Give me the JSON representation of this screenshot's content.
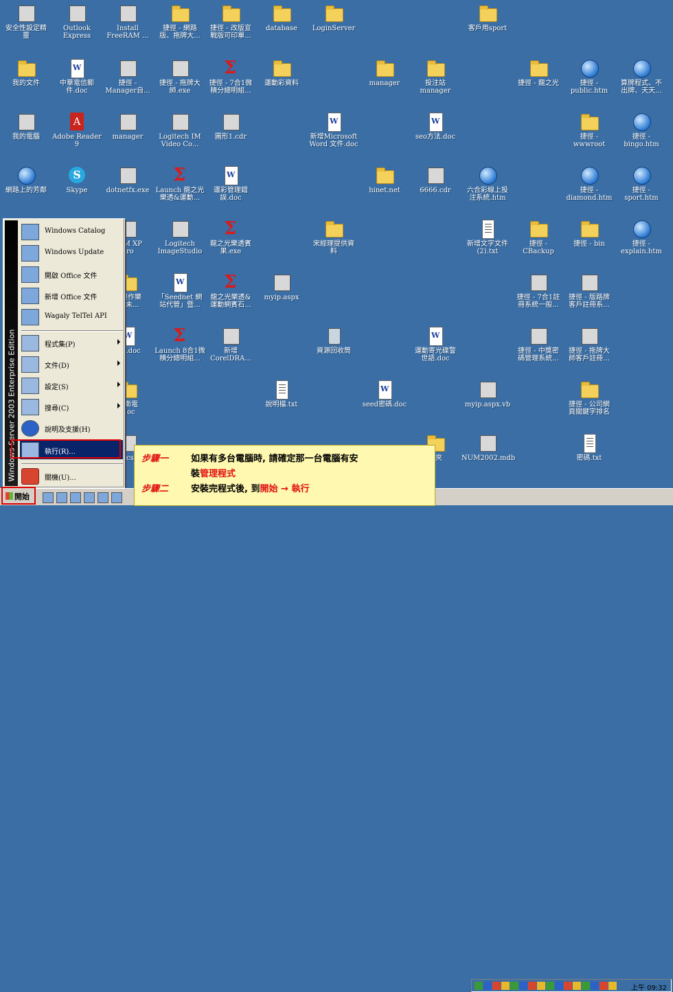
{
  "desktop": {
    "icons": [
      {
        "label": "安全性設定精\n靈",
        "kind": "generic"
      },
      {
        "label": "Outlook\nExpress",
        "kind": "generic"
      },
      {
        "label": "Install\nFreeRAM ...",
        "kind": "generic"
      },
      {
        "label": "捷徑 - 網路\n版、拖牌大...",
        "kind": "folder"
      },
      {
        "label": "捷徑 - 改版宣\n戰版可印單...",
        "kind": "folder"
      },
      {
        "label": "database",
        "kind": "folder"
      },
      {
        "label": "LoginServer",
        "kind": "folder"
      },
      {
        "label": "客戶用sport",
        "kind": "folder"
      },
      {
        "label": "我的文件",
        "kind": "folder"
      },
      {
        "label": "中華電信郵\n件.doc",
        "kind": "doc"
      },
      {
        "label": "捷徑 -\nManager自...",
        "kind": "generic"
      },
      {
        "label": "捷徑 - 拖牌大\n師.exe",
        "kind": "generic"
      },
      {
        "label": "捷徑 - 7合1微\n積分總明組...",
        "kind": "sigma"
      },
      {
        "label": "運動彩資料",
        "kind": "folder"
      },
      {
        "label": "manager",
        "kind": "folder"
      },
      {
        "label": "投注站\nmanager",
        "kind": "folder"
      },
      {
        "label": "捷徑 - 龍之光",
        "kind": "folder"
      },
      {
        "label": "捷徑 -\npublic.htm",
        "kind": "globe"
      },
      {
        "label": "算牌程式、不\n出牌、天天...",
        "kind": "globe"
      },
      {
        "label": "我的電腦",
        "kind": "generic"
      },
      {
        "label": "Adobe Reader\n9",
        "kind": "pdf"
      },
      {
        "label": "manager",
        "kind": "generic"
      },
      {
        "label": "Logitech IM\nVideo Co...",
        "kind": "generic"
      },
      {
        "label": "圖形1.cdr",
        "kind": "generic"
      },
      {
        "label": "新增Microsoft\nWord 文件.doc",
        "kind": "doc"
      },
      {
        "label": "seo方法.doc",
        "kind": "doc"
      },
      {
        "label": "捷徑 -\nwwwroot",
        "kind": "folder"
      },
      {
        "label": "捷徑 -\nbingo.htm",
        "kind": "globe"
      },
      {
        "label": "網路上的芳鄰",
        "kind": "globe"
      },
      {
        "label": "Skype",
        "kind": "skype"
      },
      {
        "label": "dotnetfx.exe",
        "kind": "generic"
      },
      {
        "label": "Launch 龍之光\n樂透&運動...",
        "kind": "sigma"
      },
      {
        "label": "運彩管理錯\n誤.doc",
        "kind": "doc"
      },
      {
        "label": "hinet.net",
        "kind": "folder"
      },
      {
        "label": "6666.cdr",
        "kind": "generic"
      },
      {
        "label": "六合彩線上投\n注系統.htm",
        "kind": "globe"
      },
      {
        "label": "捷徑 -\ndiamond.htm",
        "kind": "globe"
      },
      {
        "label": "捷徑 -\nsport.htm",
        "kind": "globe"
      },
      {
        "label": "RAM XP\nPro",
        "kind": "generic"
      },
      {
        "label": "Logitech\nImageStudio",
        "kind": "generic"
      },
      {
        "label": "龍之光樂透賓\n果.exe",
        "kind": "sigma"
      },
      {
        "label": "宋經理提供資\n料",
        "kind": "folder"
      },
      {
        "label": "新增文字文件\n(2).txt",
        "kind": "txt"
      },
      {
        "label": "捷徑 -\nCBackup",
        "kind": "folder"
      },
      {
        "label": "捷徑 - bin",
        "kind": "folder"
      },
      {
        "label": "捷徑 -\nexplain.htm",
        "kind": "globe"
      },
      {
        "label": "名製作樂\n畫(未...",
        "kind": "folder"
      },
      {
        "label": "「Seednet 網\n站代管」暨...",
        "kind": "doc"
      },
      {
        "label": "龍之光樂透&\n運動網賓石...",
        "kind": "sigma"
      },
      {
        "label": "myip.aspx",
        "kind": "generic"
      },
      {
        "label": "捷徑 - 7合1註\n冊系統一般...",
        "kind": "generic"
      },
      {
        "label": "捷徑 - 版路牌\n客戶註冊系...",
        "kind": "generic"
      },
      {
        "label": "net.doc",
        "kind": "doc"
      },
      {
        "label": "Launch 8合1微\n積分總明組...",
        "kind": "sigma"
      },
      {
        "label": "新增\nCorelDRA...",
        "kind": "generic"
      },
      {
        "label": "資源回收筒",
        "kind": "bin"
      },
      {
        "label": "運動寄光碟警\n世語.doc",
        "kind": "doc"
      },
      {
        "label": "捷徑 - 中獎密\n碼管理系統...",
        "kind": "generic"
      },
      {
        "label": "捷徑 - 拖牌大\n師客戶註冊...",
        "kind": "generic"
      },
      {
        "label": "彩南電\n.doc",
        "kind": "folder"
      },
      {
        "label": "說明檔.txt",
        "kind": "txt"
      },
      {
        "label": "seed密碼.doc",
        "kind": "doc"
      },
      {
        "label": "myip.aspx.vb",
        "kind": "generic"
      },
      {
        "label": "捷徑 - 公司網\n頁關鍵字排名",
        "kind": "folder"
      },
      {
        "label": "hcs",
        "kind": "generic"
      },
      {
        "label": "料夾",
        "kind": "folder"
      },
      {
        "label": "NUM2002.mdb",
        "kind": "generic"
      },
      {
        "label": "密碼.txt",
        "kind": "txt"
      }
    ]
  },
  "start_menu": {
    "band_text": "Windows Server 2003 Enterprise Edition",
    "top_items": [
      {
        "label": "Windows Catalog"
      },
      {
        "label": "Windows Update"
      },
      {
        "label": "開啟 Office 文件"
      },
      {
        "label": "新增 Office 文件"
      },
      {
        "label": "Wagaly TelTel API"
      }
    ],
    "items": [
      {
        "label": "程式集(P)",
        "submenu": true
      },
      {
        "label": "文件(D)",
        "submenu": true
      },
      {
        "label": "設定(S)",
        "submenu": true
      },
      {
        "label": "搜尋(C)",
        "submenu": true
      },
      {
        "label": "說明及支援(H)",
        "submenu": false
      },
      {
        "label": "執行(R)...",
        "submenu": false
      }
    ],
    "shutdown": {
      "label": "關機(U)..."
    }
  },
  "taskbar": {
    "start_label": "開始",
    "clock": "上午 09:32"
  },
  "instructions": {
    "step1_label": "步驟一",
    "step1_text": "如果有多台電腦時, 請確定那一台電腦有安",
    "step1_text2_prefix": "裝",
    "step1_highlight": "管理程式",
    "step2_label": "步驟二",
    "step2_text": "安裝完程式後, 到",
    "step2_start": "開始",
    "step2_arrow": "→",
    "step2_run": "執行"
  }
}
